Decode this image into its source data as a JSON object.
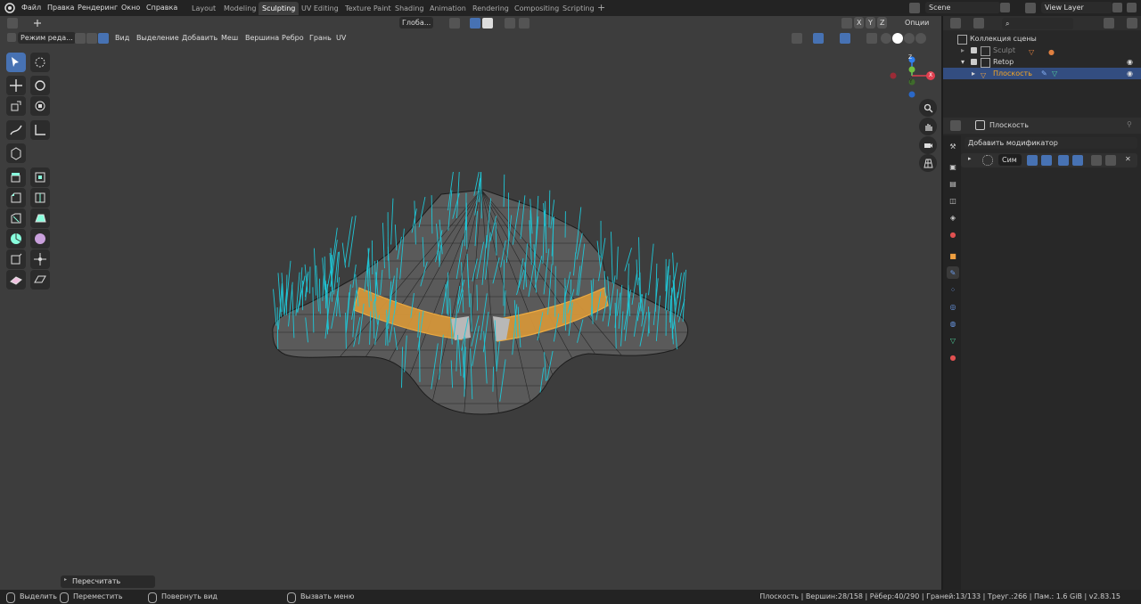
{
  "top_menu": [
    "Файл",
    "Правка",
    "Рендеринг",
    "Окно",
    "Справка"
  ],
  "workspace_tabs": [
    "Layout",
    "Modeling",
    "Sculpting",
    "UV Editing",
    "Texture Paint",
    "Shading",
    "Animation",
    "Rendering",
    "Compositing",
    "Scripting"
  ],
  "active_workspace": "Sculpting",
  "scene_name": "Scene",
  "view_layer": "View Layer",
  "header": {
    "orientation": "Глоба...",
    "mode": "Режим реда...",
    "menus": [
      "Вид",
      "Выделение",
      "Добавить",
      "Меш",
      "Вершина",
      "Ребро",
      "Грань",
      "UV"
    ],
    "axes": [
      "X",
      "Y",
      "Z"
    ],
    "options": "Опции"
  },
  "gizmo": {
    "x": "X",
    "y": "Y",
    "z": "Z"
  },
  "operator_panel": "Пересчитать нормали",
  "outliner": {
    "root": "Коллекция сцены",
    "items": [
      {
        "label": "Sculpt"
      },
      {
        "label": "Retop"
      },
      {
        "label": "Плоскость"
      }
    ]
  },
  "properties": {
    "object_name": "Плоскость",
    "add_modifier": "Добавить модификатор",
    "modifier_name": "Сим"
  },
  "status": {
    "select": "Выделить",
    "move": "Переместить",
    "rotate": "Повернуть вид",
    "menu": "Вызвать меню",
    "stats": "Плоскость | Вершин:28/158 | Рёбер:40/290 | Граней:13/133 | Треуг.:266 | Пам.: 1.6 GiB | v2.83.15"
  },
  "colors": {
    "accent": "#4772b3",
    "selection": "#f5a623",
    "normals": "#1fc6d6",
    "viewport": "#3d3d3d"
  }
}
